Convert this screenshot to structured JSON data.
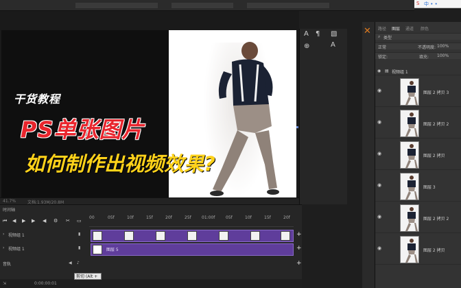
{
  "overlay": {
    "subtitle": "干货教程",
    "title": "PS单张图片",
    "question": "如何制作出视频效果?"
  },
  "status_bar": {
    "zoom": "41.7%",
    "doc_info": "文档:1.93M/20.8M"
  },
  "tools": {
    "char_icon": "A",
    "para_icon": "¶",
    "glyph_icon": "A",
    "adjust_icon": "⊕"
  },
  "layers_panel": {
    "tabs": [
      "路径",
      "图层",
      "通道",
      "颜色"
    ],
    "active_tab": "图层",
    "filter_label": "类型",
    "blend_mode": "正常",
    "opacity_label": "不透明度:",
    "opacity_value": "100%",
    "lock_label": "锁定:",
    "fill_label": "填充:",
    "fill_value": "100%",
    "group_name": "视频组 1",
    "layers": [
      "图层 2 拷贝 3",
      "图层 2 拷贝 2",
      "图层 2 拷贝",
      "图层 3",
      "图层 2 拷贝 2",
      "图层 2 拷贝"
    ]
  },
  "timeline": {
    "title": "时间轴",
    "ruler": [
      "00",
      "05f",
      "10f",
      "15f",
      "20f",
      "25f",
      "01:00f",
      "05f",
      "10f",
      "15f",
      "20f"
    ],
    "tracks": [
      "视频组 1",
      "视频组 1"
    ],
    "audio_label": "音轨",
    "clip2_label": "图层 5",
    "time_readout": "0:00:00:01",
    "tooltip": "剪切 (Alt + A)"
  },
  "browser_badge": {
    "text": "中 • •"
  },
  "colors": {
    "title_red": "#e8252d",
    "question_yellow": "#ffd21a",
    "clip_purple": "#5f3d9b",
    "accent_orange": "#e07b1f"
  }
}
